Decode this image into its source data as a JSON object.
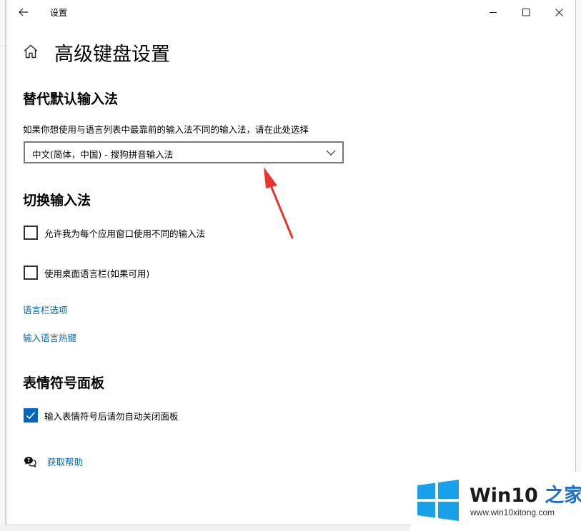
{
  "titlebar": {
    "title": "设置",
    "back_icon": "back-arrow-icon",
    "minimize_icon": "minimize-icon",
    "maximize_icon": "maximize-icon",
    "close_icon": "close-icon"
  },
  "header": {
    "home_icon": "home-icon",
    "title": "高级键盘设置"
  },
  "override_section": {
    "title": "替代默认输入法",
    "description": "如果你想使用与语言列表中最靠前的输入法不同的输入法，请在此处选择",
    "selected_value": "中文(简体，中国) - 搜狗拼音输入法",
    "chevron_icon": "chevron-down-icon"
  },
  "switch_section": {
    "title": "切换输入法",
    "options": [
      {
        "label": "允许我为每个应用窗口使用不同的输入法",
        "checked": false
      },
      {
        "label": "使用桌面语言栏(如果可用)",
        "checked": false
      }
    ],
    "links": [
      {
        "label": "语言栏选项"
      },
      {
        "label": "输入语言热键"
      }
    ]
  },
  "emoji_section": {
    "title": "表情符号面板",
    "option": {
      "label": "输入表情符号后请勿自动关闭面板",
      "checked": true
    }
  },
  "help": {
    "icon": "help-chat-icon",
    "label": "获取帮助"
  },
  "annotation": {
    "arrow_color": "#e8342a"
  },
  "watermark": {
    "brand_main": "Win10 ",
    "brand_accent": "之家",
    "url": "www.win10xitong.com"
  },
  "colors": {
    "accent": "#0067c0",
    "link": "#0067b8"
  }
}
